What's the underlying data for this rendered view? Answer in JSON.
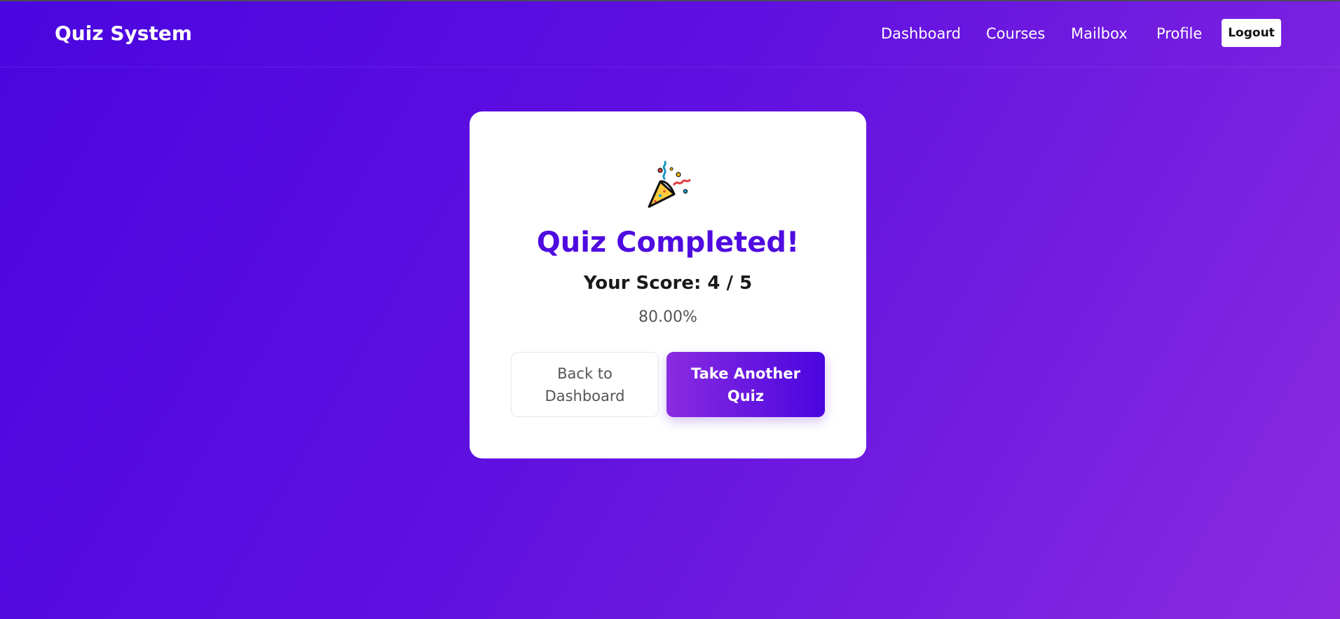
{
  "header": {
    "brand": "Quiz System",
    "nav": [
      "Dashboard",
      "Courses",
      "Mailbox",
      "Profile"
    ],
    "logout_label": "Logout"
  },
  "result": {
    "icon": "party-popper-icon",
    "title": "Quiz Completed!",
    "score_text": "Your Score: 4 / 5",
    "percent_text": "80.00%",
    "back_label": "Back to Dashboard",
    "take_another_label": "Take Another Quiz"
  },
  "colors": {
    "accent": "#4f0be0",
    "gradient_start": "#4a06df",
    "gradient_end": "#8a2be0"
  }
}
